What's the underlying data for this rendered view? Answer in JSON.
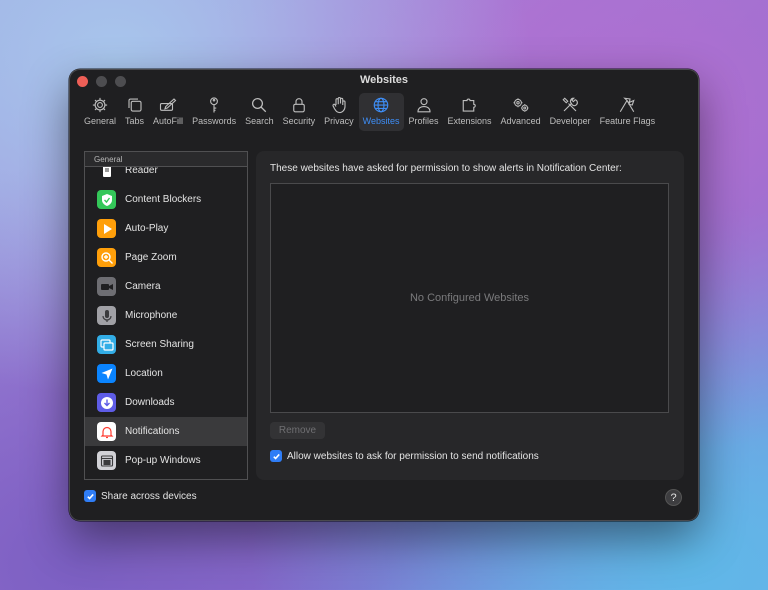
{
  "window": {
    "title": "Websites"
  },
  "toolbar": {
    "items": [
      {
        "label": "General",
        "icon": "gear-icon"
      },
      {
        "label": "Tabs",
        "icon": "tabs-icon"
      },
      {
        "label": "AutoFill",
        "icon": "autofill-icon"
      },
      {
        "label": "Passwords",
        "icon": "key-icon"
      },
      {
        "label": "Search",
        "icon": "search-icon"
      },
      {
        "label": "Security",
        "icon": "lock-icon"
      },
      {
        "label": "Privacy",
        "icon": "hand-icon"
      },
      {
        "label": "Websites",
        "icon": "globe-icon",
        "active": true
      },
      {
        "label": "Profiles",
        "icon": "person-icon"
      },
      {
        "label": "Extensions",
        "icon": "puzzle-icon"
      },
      {
        "label": "Advanced",
        "icon": "gears-icon"
      },
      {
        "label": "Developer",
        "icon": "tools-icon"
      },
      {
        "label": "Feature Flags",
        "icon": "flags-icon"
      }
    ],
    "accent": "#3e8ef7"
  },
  "sidebar": {
    "header": "General",
    "items": [
      {
        "label": "Reader",
        "icon": "reader-icon",
        "color": "#ffffff"
      },
      {
        "label": "Content Blockers",
        "icon": "shield-check-icon",
        "color": "#34c759"
      },
      {
        "label": "Auto-Play",
        "icon": "play-icon",
        "color": "#ff9f0a"
      },
      {
        "label": "Page Zoom",
        "icon": "zoom-icon",
        "color": "#ff9f0a"
      },
      {
        "label": "Camera",
        "icon": "camera-icon",
        "color": "#6e6e73"
      },
      {
        "label": "Microphone",
        "icon": "microphone-icon",
        "color": "#a1a1a6"
      },
      {
        "label": "Screen Sharing",
        "icon": "screen-sharing-icon",
        "color": "#32ade6"
      },
      {
        "label": "Location",
        "icon": "location-icon",
        "color": "#0a84ff"
      },
      {
        "label": "Downloads",
        "icon": "download-icon",
        "color": "#5e5ce6"
      },
      {
        "label": "Notifications",
        "icon": "bell-icon",
        "color": "#ffffff",
        "selected": true
      },
      {
        "label": "Pop-up Windows",
        "icon": "popup-icon",
        "color": "#d1d1d6"
      }
    ]
  },
  "content": {
    "description": "These websites have asked for permission to show alerts in Notification Center:",
    "empty_text": "No Configured Websites",
    "remove_label": "Remove",
    "allow_label": "Allow websites to ask for permission to send notifications",
    "allow_checked": true
  },
  "footer": {
    "share_label": "Share across devices",
    "share_checked": true,
    "help_label": "?"
  }
}
